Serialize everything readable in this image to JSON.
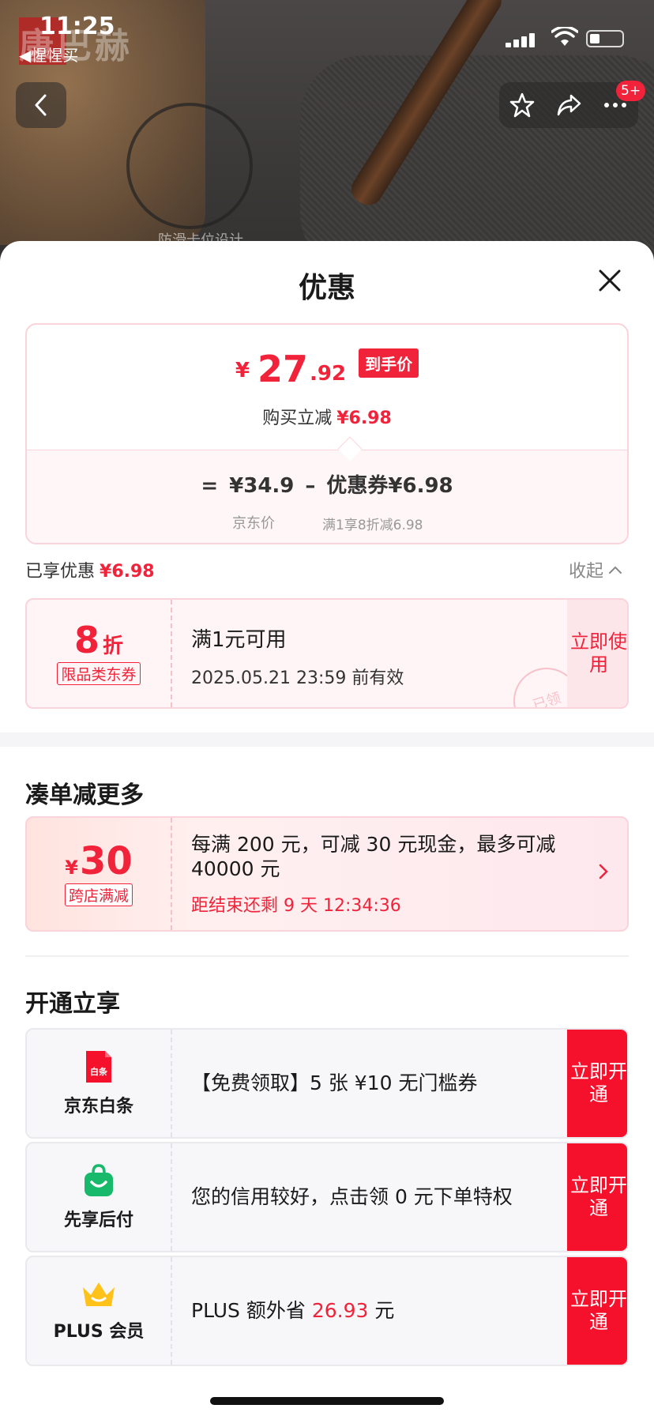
{
  "status_bar": {
    "time": "11:25",
    "back_app": "◀惺惺买"
  },
  "nav": {
    "badge": "5+"
  },
  "background": {
    "brand": "康巴赫",
    "hint": "防滑卡位设计"
  },
  "sheet": {
    "title": "优惠"
  },
  "price_card": {
    "yen": "¥",
    "price_int": "27",
    "price_dec": ".92",
    "price_tag": "到手价",
    "reduce_label": "购买立减",
    "reduce_amount": "¥6.98",
    "formula_eq": "=",
    "jd_price": "¥34.9",
    "formula_minus": "–",
    "coupon_part": "优惠券¥6.98",
    "jd_price_label": "京东价",
    "coupon_part_label": "满1享8折减6.98"
  },
  "enjoyed": {
    "label": "已享优惠",
    "amount": "¥6.98",
    "collapse": "收起"
  },
  "coupon": {
    "value": "8",
    "unit": "折",
    "type": "限品类东券",
    "condition": "满1元可用",
    "validity": "2025.05.21 23:59 前有效",
    "stamp": "已领",
    "use_button": "立即使用"
  },
  "promo_section": {
    "title": "凑单减更多",
    "yen": "¥",
    "value": "30",
    "type": "跨店满减",
    "description": "每满 200 元，可减 30 元现金，最多可减 40000 元",
    "countdown": "距结束还剩 9 天 12:34:36"
  },
  "open_section": {
    "title": "开通立享",
    "cards": [
      {
        "name": "京东白条",
        "icon": "baitiao-icon",
        "icon_text": "白条",
        "description": "【免费领取】5 张 ¥10 无门槛券",
        "button": "立即开通"
      },
      {
        "name": "先享后付",
        "icon": "shopping-bag-icon",
        "description": "您的信用较好，点击领 0 元下单特权",
        "button": "立即开通"
      },
      {
        "name": "PLUS 会员",
        "icon": "crown-icon",
        "description_prefix": "PLUS 额外省 ",
        "description_amount": "26.93",
        "description_suffix": " 元",
        "button": "立即开通"
      }
    ]
  },
  "colors": {
    "accent_red": "#f0233a",
    "button_red": "#f5102b",
    "coupon_border": "#fbd3da"
  }
}
